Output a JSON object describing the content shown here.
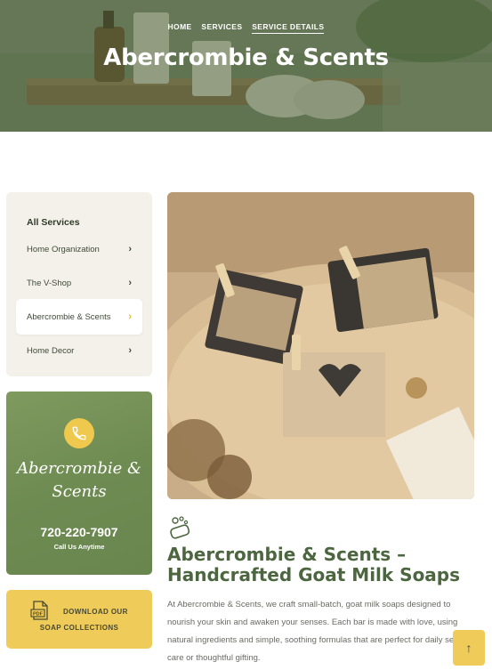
{
  "breadcrumb": {
    "items": [
      "HOME",
      "SERVICES",
      "SERVICE DETAILS"
    ]
  },
  "hero": {
    "title": "Abercrombie & Scents"
  },
  "sidebar": {
    "heading": "All Services",
    "items": [
      {
        "label": "Home Organization",
        "active": false
      },
      {
        "label": "The V-Shop",
        "active": false
      },
      {
        "label": "Abercrombie & Scents",
        "active": true
      },
      {
        "label": "Home Decor",
        "active": false
      }
    ]
  },
  "contact": {
    "brand_line1": "Abercrombie &",
    "brand_line2": "Scents",
    "phone": "720-220-7907",
    "caption": "Call Us Anytime"
  },
  "download": {
    "line1": "DOWNLOAD OUR",
    "line2": "SOAP COLLECTIONS",
    "icon_label": "PDF"
  },
  "content": {
    "title": "Abercrombie & Scents – Handcrafted Goat Milk Soaps",
    "body": "At Abercrombie & Scents, we craft small-batch, goat milk soaps designed to nourish your skin and awaken your senses. Each bar is made with love, using natural ingredients and simple, soothing formulas that are perfect for daily self-care or thoughtful gifting."
  },
  "scroll_top": {
    "icon": "↑"
  },
  "colors": {
    "accent": "#efcb5a",
    "green": "#4c6640",
    "sidebar_bg": "#f4f1ea"
  }
}
